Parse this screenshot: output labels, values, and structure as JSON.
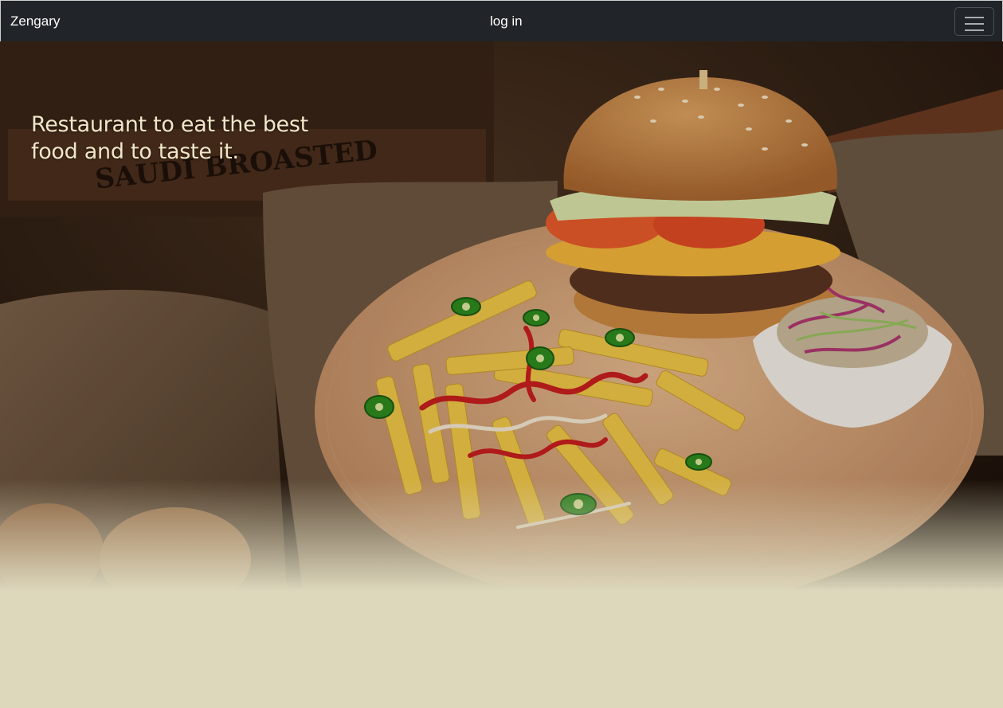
{
  "navbar": {
    "brand": "Zengary",
    "login_label": "log in",
    "menu_icon": "hamburger-menu-icon",
    "background": "#212529"
  },
  "hero": {
    "title": "Restaurant to eat the best food and to taste it.",
    "image_subject": "burger-fries-coleslaw-photo",
    "title_color": "#f0e6c8"
  },
  "page": {
    "background": "#ddd7bc"
  }
}
